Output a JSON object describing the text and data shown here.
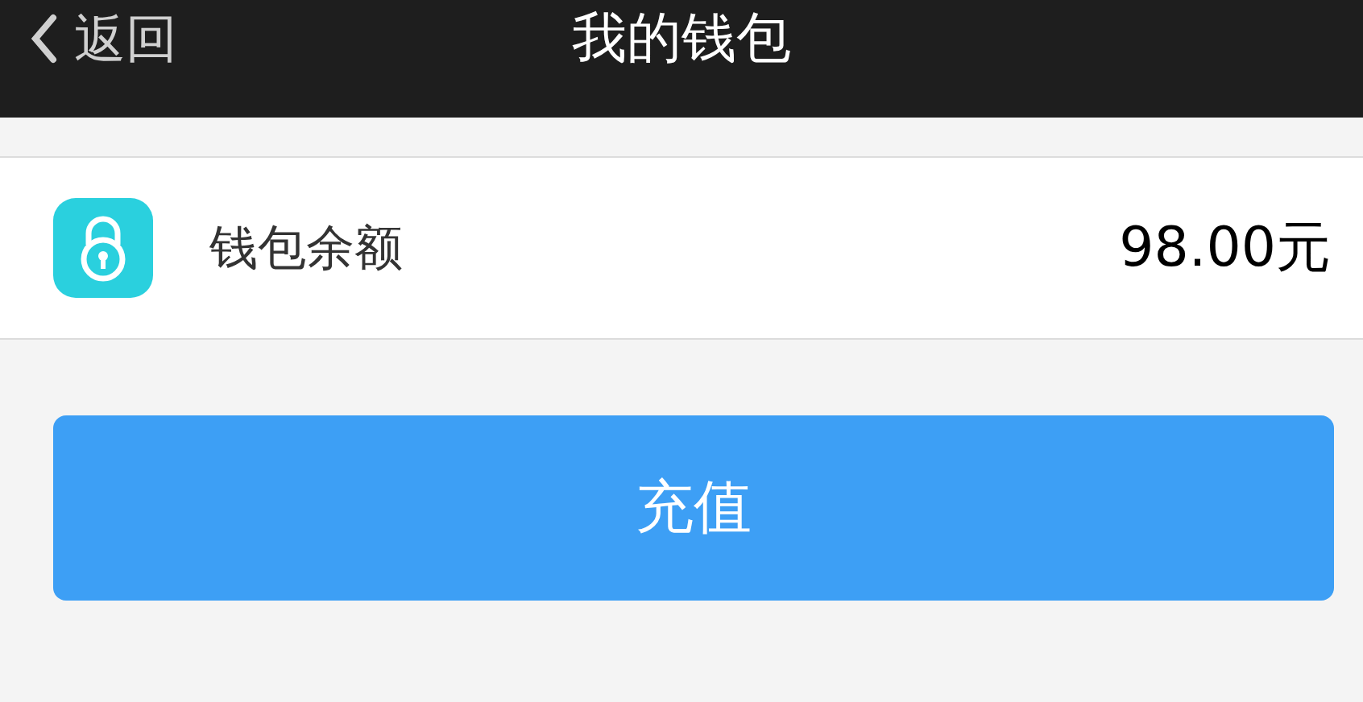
{
  "header": {
    "back": "返回",
    "title": "我的钱包"
  },
  "balance": {
    "label": "钱包余额",
    "amount": "98.00元"
  },
  "recharge_button": "充值"
}
